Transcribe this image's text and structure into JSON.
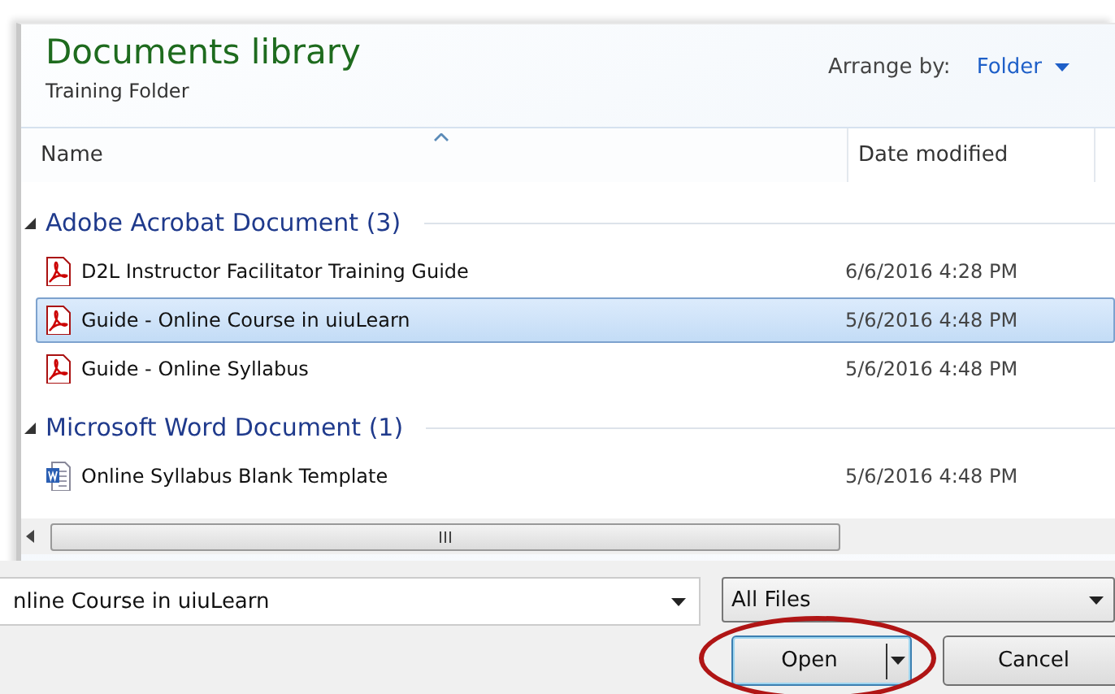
{
  "header": {
    "title": "Documents library",
    "subtitle": "Training Folder",
    "arrange_label": "Arrange by:",
    "arrange_value": "Folder"
  },
  "columns": [
    {
      "label": "Name",
      "sorted": true
    },
    {
      "label": "Date modified",
      "sorted": false
    }
  ],
  "groups": [
    {
      "label": "Adobe Acrobat Document (3)",
      "expanded": true,
      "files": [
        {
          "kind": "pdf",
          "name": "D2L Instructor Facilitator Training Guide",
          "date": "6/6/2016 4:28 PM",
          "selected": false
        },
        {
          "kind": "pdf",
          "name": "Guide - Online Course in uiuLearn",
          "date": "5/6/2016 4:48 PM",
          "selected": true
        },
        {
          "kind": "pdf",
          "name": "Guide - Online Syllabus",
          "date": "5/6/2016 4:48 PM",
          "selected": false
        }
      ]
    },
    {
      "label": "Microsoft Word Document (1)",
      "expanded": true,
      "files": [
        {
          "kind": "word",
          "name": "Online Syllabus Blank Template",
          "date": "5/6/2016 4:48 PM",
          "selected": false
        }
      ]
    }
  ],
  "filename": {
    "value": "nline Course in uiuLearn"
  },
  "filetype": {
    "value": "All Files"
  },
  "buttons": [
    {
      "label": "Open",
      "kind": "split",
      "circled": true
    },
    {
      "label": "Cancel",
      "kind": "plain",
      "circled": false
    }
  ]
}
